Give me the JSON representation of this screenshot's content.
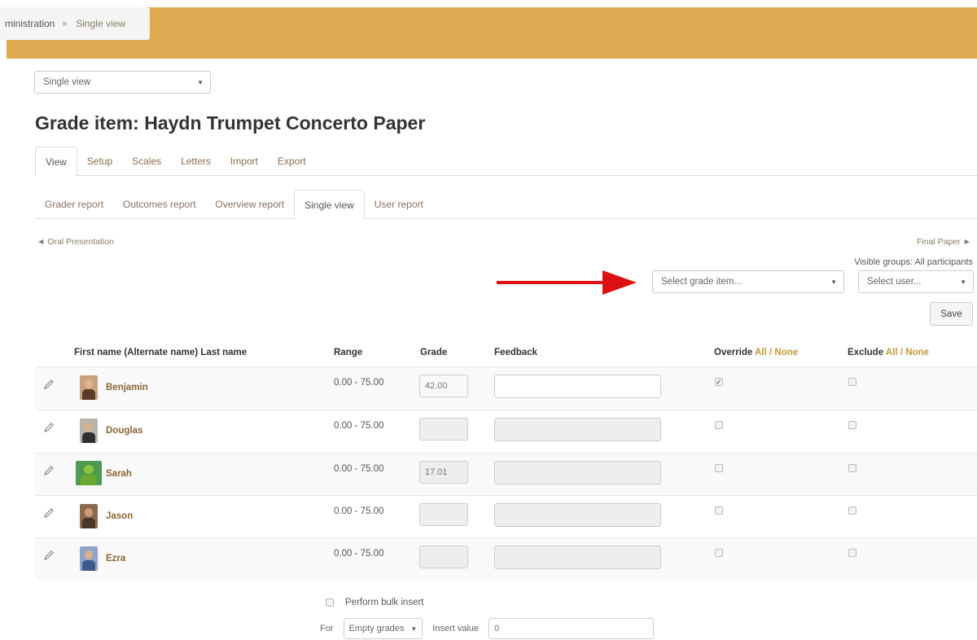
{
  "breadcrumb": {
    "part1": "ministration",
    "separator": "►",
    "current": "Single view"
  },
  "report_selector": {
    "value": "Single view"
  },
  "page_title": "Grade item: Haydn Trumpet Concerto Paper",
  "tabs_primary": [
    "View",
    "Setup",
    "Scales",
    "Letters",
    "Import",
    "Export"
  ],
  "tabs_secondary": [
    "Grader report",
    "Outcomes report",
    "Overview report",
    "Single view",
    "User report"
  ],
  "nav": {
    "prev": "◄ Oral Presentation",
    "next": "Final Paper ►"
  },
  "visible_groups": "Visible groups: All participants",
  "grade_item_select": {
    "placeholder": "Select grade item..."
  },
  "user_select": {
    "placeholder": "Select user..."
  },
  "save_label": "Save",
  "columns": {
    "name": "First name (Alternate name) Last name",
    "range": "Range",
    "grade": "Grade",
    "feedback": "Feedback",
    "override": "Override",
    "exclude": "Exclude",
    "all": "All",
    "slash": "/",
    "none": "None"
  },
  "rows": [
    {
      "name": "Benjamin",
      "range": "0.00 - 75.00",
      "grade": "42.00",
      "override": true
    },
    {
      "name": "Douglas",
      "range": "0.00 - 75.00",
      "grade": "",
      "override": false
    },
    {
      "name": "Sarah",
      "range": "0.00 - 75.00",
      "grade": "17.01",
      "override": false
    },
    {
      "name": "Jason",
      "range": "0.00 - 75.00",
      "grade": "",
      "override": false
    },
    {
      "name": "Ezra",
      "range": "0.00 - 75.00",
      "grade": "",
      "override": false
    }
  ],
  "bulk": {
    "label": "Perform bulk insert",
    "for_label": "For",
    "for_value": "Empty grades",
    "insert_label": "Insert value",
    "insert_value": "0"
  },
  "colors": {
    "header_band": "#deab52",
    "link": "#c49b3a",
    "arrow": "#dd1111"
  }
}
